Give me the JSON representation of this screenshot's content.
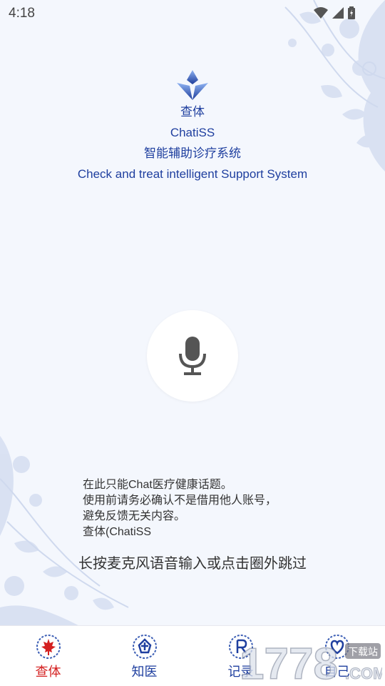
{
  "status_bar": {
    "time": "4:18"
  },
  "header": {
    "name_cn": "查体",
    "name_en": "ChatiSS",
    "subtitle_cn": "智能辅助诊疗系统",
    "subtitle_en": "Check and treat intelligent Support System"
  },
  "mic": {
    "icon": "microphone-icon"
  },
  "notice": {
    "lines": [
      "在此只能Chat医疗健康话题。",
      "使用前请务必确认不是借用他人账号，",
      "避免反馈无关内容。",
      "查体(ChatiSS"
    ]
  },
  "prompt": "长按麦克风语音输入或点击圈外跳过",
  "nav": {
    "items": [
      {
        "label": "查体",
        "icon": "maple-leaf-icon",
        "active": true
      },
      {
        "label": "知医",
        "icon": "medical-emblem-icon",
        "active": false
      },
      {
        "label": "记录",
        "icon": "record-icon",
        "active": false
      },
      {
        "label": "自己",
        "icon": "heart-icon",
        "active": false
      }
    ]
  },
  "watermark": {
    "number": "1778",
    "suffix": ".COM",
    "tag": "下载站"
  },
  "colors": {
    "brand_blue": "#1f3f9f",
    "active_red": "#d42020",
    "background": "#f4f7fd"
  }
}
